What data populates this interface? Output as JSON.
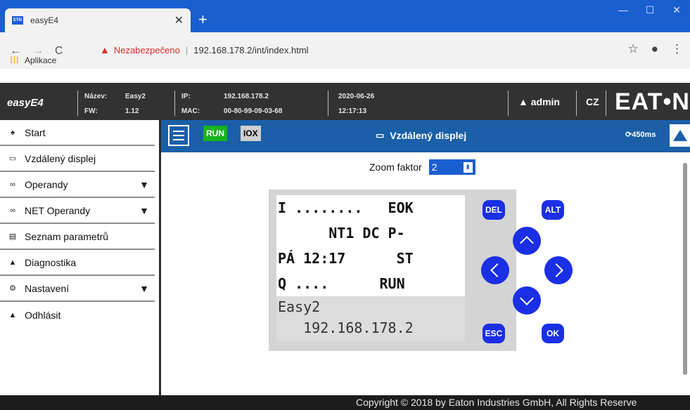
{
  "browser": {
    "tab_title": "easyE4",
    "tab_favicon": "ETN",
    "url_warning": "Nezabezpečeno",
    "url": "192.168.178.2/int/index.html",
    "bookmarks_label": "Aplikace"
  },
  "header": {
    "brand": "easyE4",
    "name_label": "Název:",
    "name_value": "Easy2",
    "fw_label": "FW:",
    "fw_value": "1.12",
    "ip_label": "IP:",
    "ip_value": "192.168.178.2",
    "mac_label": "MAC:",
    "mac_value": "00-80-99-09-03-68",
    "date": "2020-06-26",
    "time": "12:17:13",
    "user": "admin",
    "lang": "CZ",
    "logo": "EAT•N"
  },
  "sidebar": {
    "items": [
      {
        "label": "Start",
        "icon": "home-icon"
      },
      {
        "label": "Vzdálený displej",
        "icon": "monitor-icon"
      },
      {
        "label": "Operandy",
        "icon": "glasses-icon"
      },
      {
        "label": "NET Operandy",
        "icon": "glasses-icon"
      },
      {
        "label": "Seznam parametrů",
        "icon": "list-icon"
      },
      {
        "label": "Diagnostika",
        "icon": "warning-icon"
      },
      {
        "label": "Nastavení",
        "icon": "gear-icon"
      },
      {
        "label": "Odhlásit",
        "icon": "user-icon"
      }
    ]
  },
  "toolbar": {
    "run": "RUN",
    "iox": "IOX",
    "title": "Vzdálený displej",
    "cycle": "450ms"
  },
  "zoom": {
    "label": "Zoom faktor",
    "value": "2"
  },
  "lcd": {
    "line1": "I ........   EOK",
    "line2": "      NT1 DC P-",
    "line3": "PÁ 12:17      ST",
    "line4": "Q ....      RUN",
    "line5": "Easy2",
    "line6": "   192.168.178.2"
  },
  "keys": {
    "del": "DEL",
    "alt": "ALT",
    "esc": "ESC",
    "ok": "OK"
  },
  "footer": {
    "copyright": "Copyright © 2018 by Eaton Industries GmbH, All Rights Reserve"
  },
  "colors": {
    "chrome_blue": "#1a5fd0",
    "toolbar_blue": "#1a5fa8",
    "header_dark": "#323232",
    "run_green": "#18b21e",
    "key_blue": "#1a2fe6"
  }
}
